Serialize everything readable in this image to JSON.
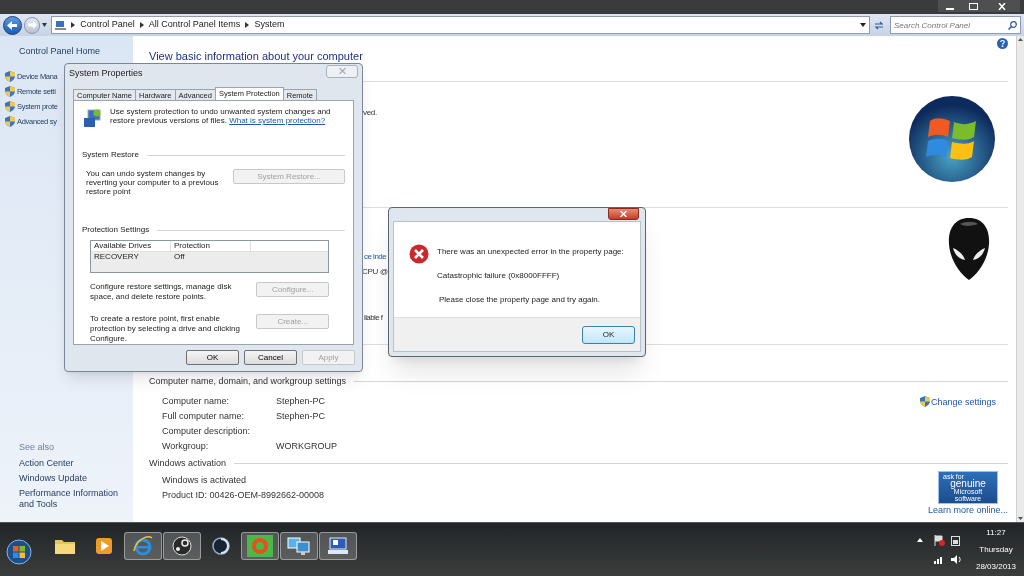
{
  "address_bar": {
    "breadcrumbs": [
      "Control Panel",
      "All Control Panel Items",
      "System"
    ]
  },
  "search": {
    "placeholder": "Search Control Panel"
  },
  "sidebar": {
    "home": "Control Panel Home",
    "tasks": [
      "Device Mana",
      "Remote setti",
      "System prote",
      "Advanced sy"
    ],
    "see_also_heading": "See also",
    "see_also": [
      "Action Center",
      "Windows Update",
      "Performance Information and Tools"
    ]
  },
  "main": {
    "title": "View basic information about your computer",
    "edition_fragments": [
      {
        "kind": "text",
        "text": "ved."
      }
    ],
    "system_fragments": [
      {
        "kind": "link",
        "text": "ce Inde"
      },
      {
        "kind": "text",
        "text": "CPU @"
      },
      {
        "kind": "text",
        "text": "ilable f"
      }
    ],
    "computer_settings": {
      "heading": "Computer name, domain, and workgroup settings",
      "change_settings": "Change settings",
      "rows": [
        {
          "label": "Computer name:",
          "value": "Stephen-PC"
        },
        {
          "label": "Full computer name:",
          "value": "Stephen-PC"
        },
        {
          "label": "Computer description:"
        },
        {
          "label": "Workgroup:",
          "value": "WORKGROUP"
        }
      ]
    },
    "activation": {
      "heading": "Windows activation",
      "lines": [
        "Windows is activated",
        "Product ID: 00426-OEM-8992662-00008"
      ],
      "badge": [
        "ask for",
        "genuine",
        "Microsoft",
        "software"
      ],
      "learn_more": "Learn more online..."
    }
  },
  "system_properties": {
    "title": "System Properties",
    "tabs": [
      {
        "label": "Computer Name",
        "selected": false
      },
      {
        "label": "Hardware",
        "selected": false
      },
      {
        "label": "Advanced",
        "selected": false
      },
      {
        "label": "System Protection",
        "selected": true
      },
      {
        "label": "Remote",
        "selected": false
      }
    ],
    "intro": "Use system protection to undo unwanted system changes and restore previous versions of files.",
    "intro_link": "What is system protection?",
    "restore": {
      "heading": "System Restore",
      "text": "You can undo system changes by reverting your computer to a previous restore point",
      "button": {
        "label": "System Restore...",
        "disabled": true
      }
    },
    "protection": {
      "heading": "Protection Settings",
      "columns": [
        "Available Drives",
        "Protection"
      ],
      "rows": [
        [
          "RECOVERY",
          "Off"
        ]
      ],
      "actions": [
        {
          "text": "Configure restore settings, manage disk space, and delete restore points.",
          "button": {
            "label": "Configure...",
            "disabled": true
          }
        },
        {
          "text": "To create a restore point, first enable protection by selecting a drive and clicking Configure.",
          "button": {
            "label": "Create...",
            "disabled": true
          }
        }
      ]
    },
    "buttons": [
      {
        "label": "OK",
        "disabled": false
      },
      {
        "label": "Cancel",
        "disabled": false
      },
      {
        "label": "Apply",
        "disabled": true
      }
    ]
  },
  "error_dialog": {
    "lines": [
      "There was an unexpected error in the property page:",
      "Catastrophic failure (0x8000FFFF)",
      "Please close the property page and try again."
    ],
    "button": "OK"
  },
  "taskbar": {
    "apps": [
      {
        "kind": "folder",
        "running": false
      },
      {
        "kind": "media",
        "running": false
      },
      {
        "kind": "browser",
        "running": true
      },
      {
        "kind": "steam",
        "running": true
      },
      {
        "kind": "disc",
        "running": false
      },
      {
        "kind": "ring",
        "running": true
      },
      {
        "kind": "monitors",
        "running": true
      },
      {
        "kind": "sysprops",
        "running": true
      }
    ],
    "clock": {
      "time": "11:27",
      "day": "Thursday",
      "date": "28/03/2013"
    }
  }
}
